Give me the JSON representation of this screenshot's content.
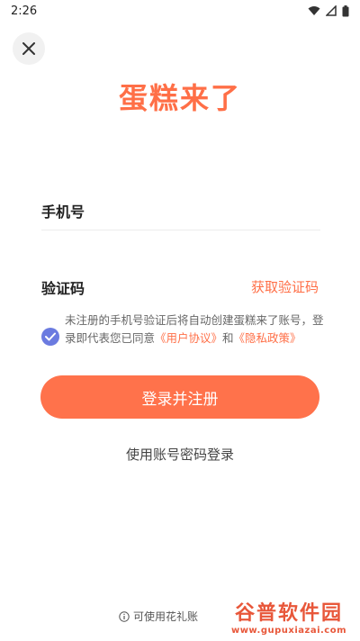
{
  "status_bar": {
    "time": "2:26"
  },
  "logo": {
    "text": "蛋糕来了"
  },
  "phone_field": {
    "label": "手机号"
  },
  "code_field": {
    "label": "验证码",
    "get_code_label": "获取验证码"
  },
  "agreement": {
    "text_part1": "未注册的手机号验证后将自动创建蛋糕来了账号，登录即代表您已同意",
    "user_agreement": "《用户协议》",
    "and": "和",
    "privacy_policy": "《隐私政策》"
  },
  "register_button": {
    "label": "登录并注册"
  },
  "password_login": {
    "label": "使用账号密码登录"
  },
  "footer": {
    "text": "可使用花礼账"
  },
  "watermark": {
    "title": "谷普软件园",
    "url": "www.gupuxiazai.com"
  },
  "colors": {
    "accent": "#ff724b",
    "check": "#6b7be0"
  }
}
